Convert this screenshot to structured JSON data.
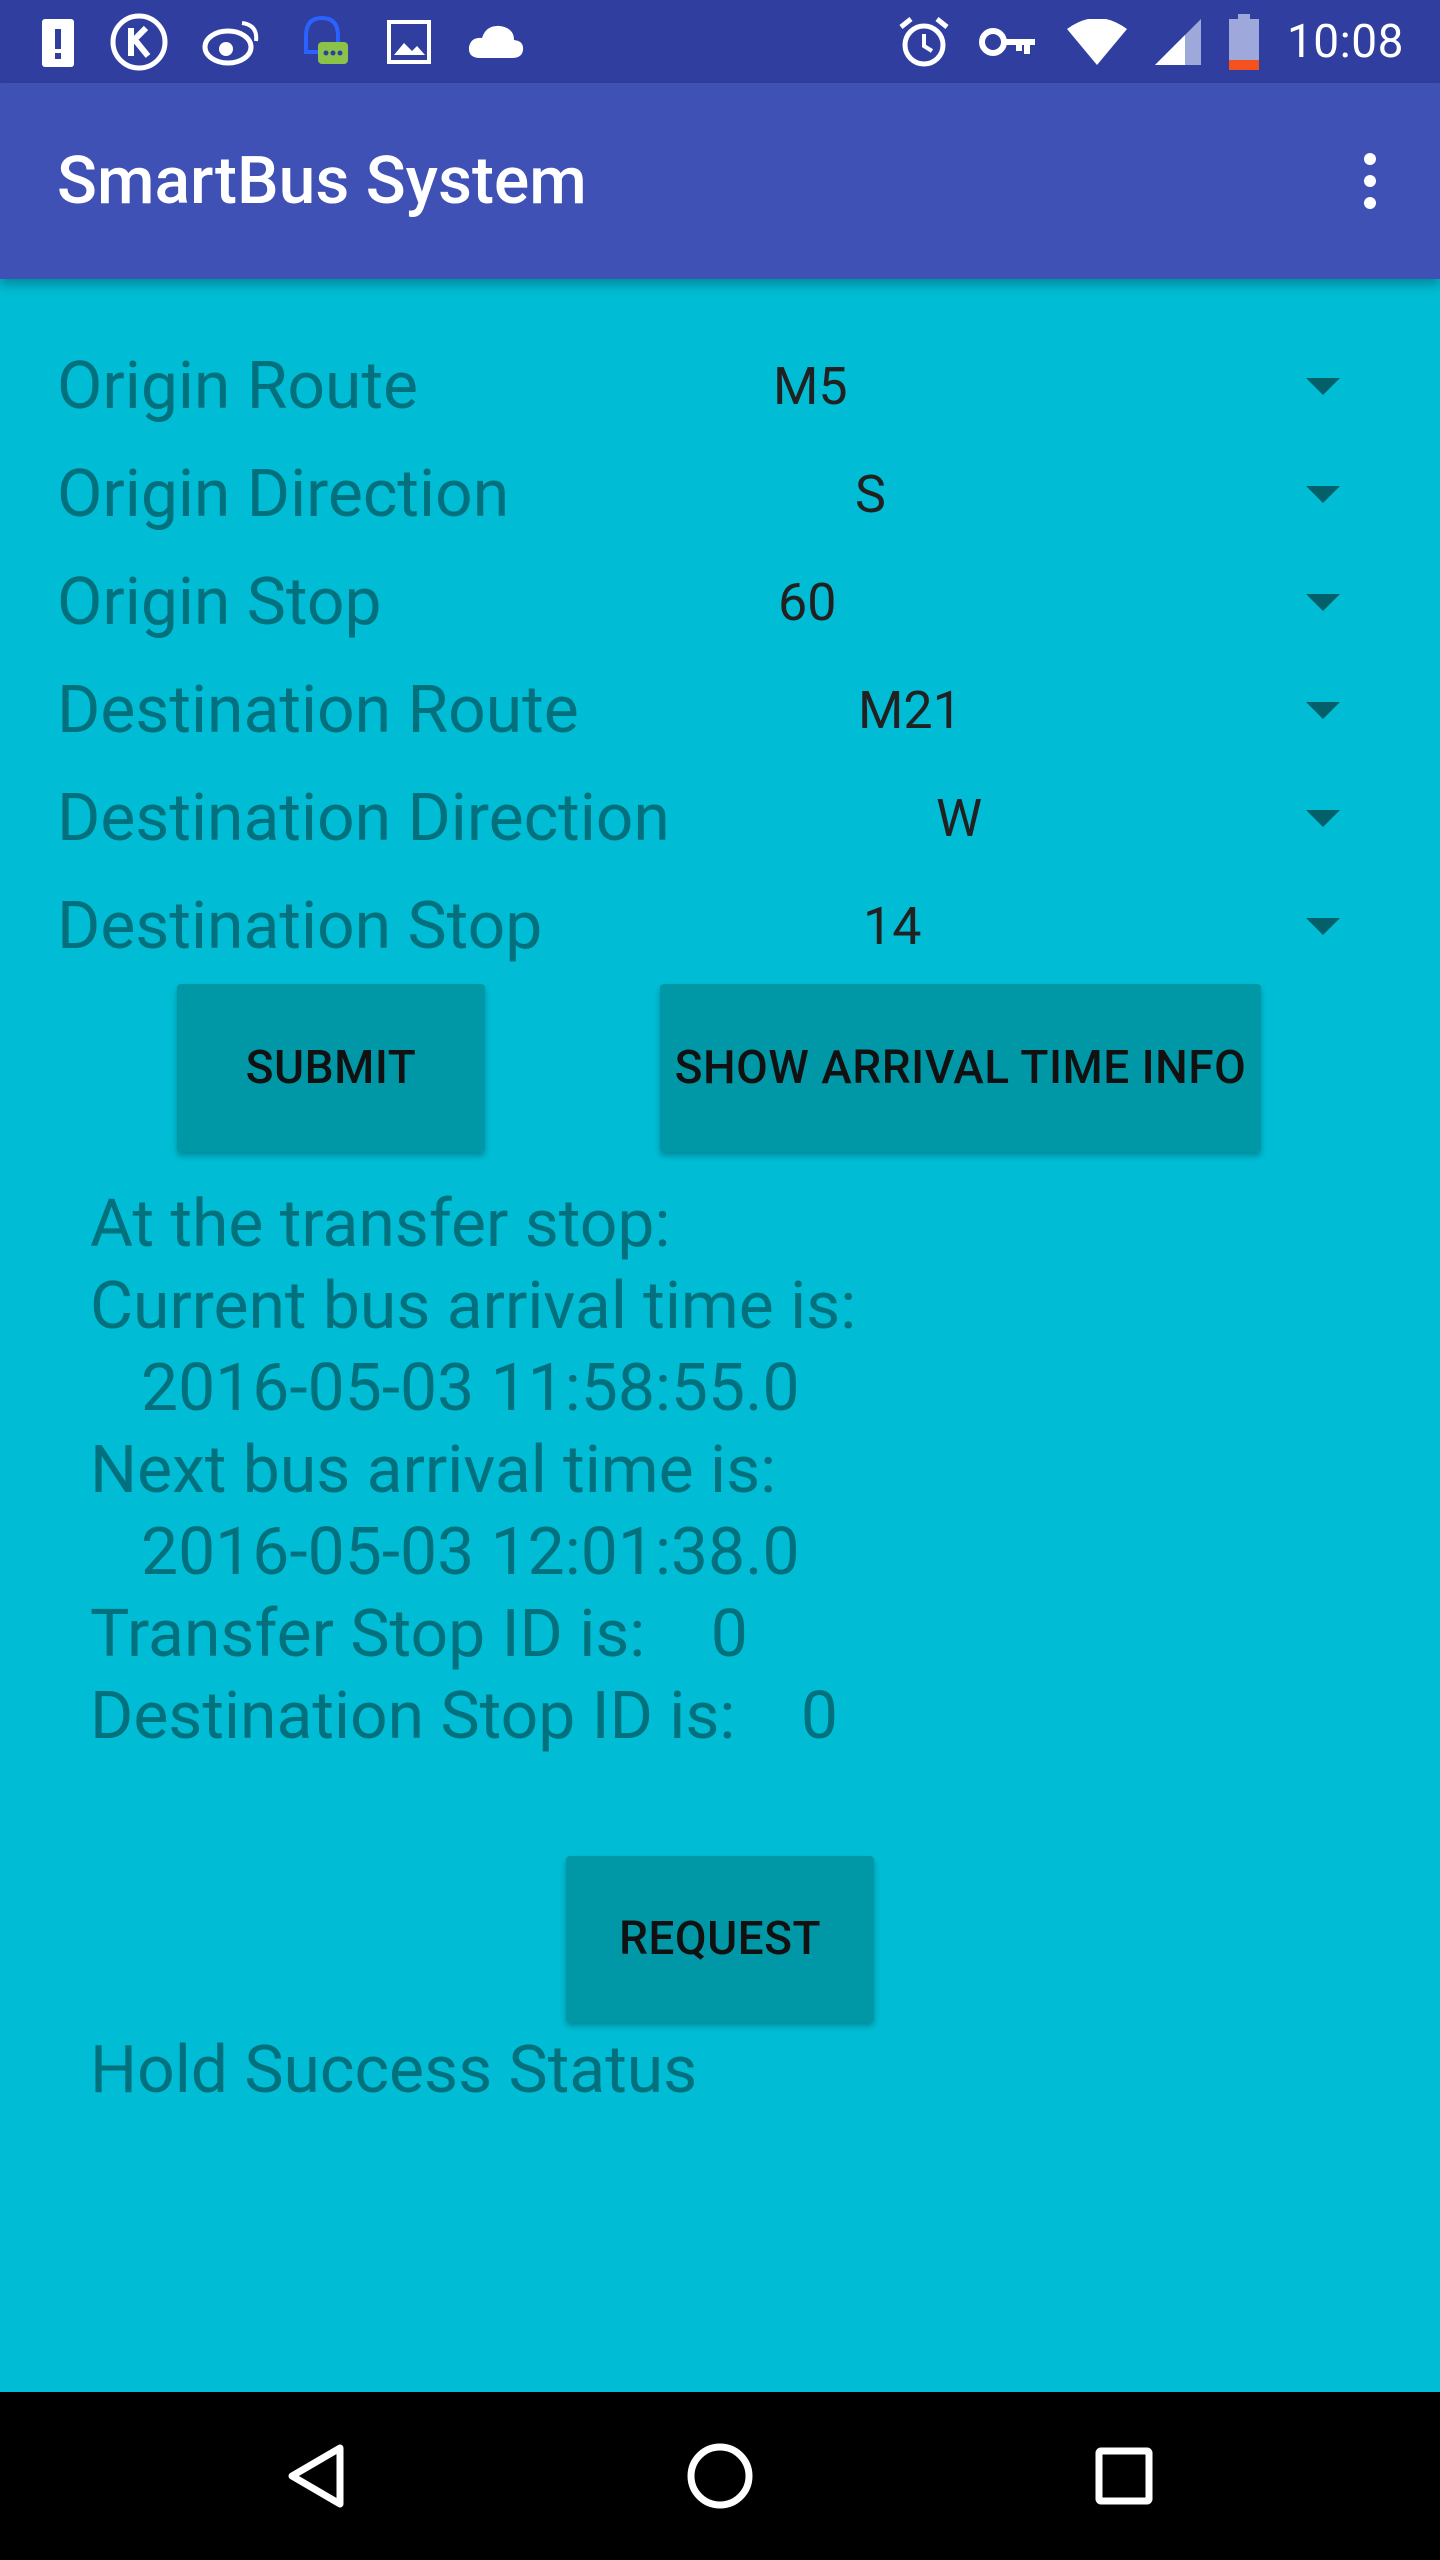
{
  "status_bar": {
    "time": "10:08",
    "left_icons": [
      "alert-icon",
      "k-app-icon",
      "weibo-icon",
      "chat-bell-icon",
      "image-icon",
      "cloud-icon"
    ],
    "right_icons": [
      "alarm-icon",
      "vpn-key-icon",
      "wifi-icon",
      "signal-icon",
      "battery-icon"
    ]
  },
  "app_bar": {
    "title": "SmartBus System",
    "menu_icon": "more-vert-icon"
  },
  "form": {
    "origin_route": {
      "label": "Origin Route",
      "value": "M5"
    },
    "origin_direction": {
      "label": "Origin Direction",
      "value": "S"
    },
    "origin_stop": {
      "label": "Origin Stop",
      "value": "60"
    },
    "destination_route": {
      "label": "Destination Route",
      "value": "M21"
    },
    "destination_direction": {
      "label": "Destination Direction",
      "value": "W"
    },
    "destination_stop": {
      "label": "Destination Stop",
      "value": "14"
    }
  },
  "buttons": {
    "submit": "SUBMIT",
    "show_arrival": "SHOW ARRIVAL TIME INFO",
    "request": "REQUEST"
  },
  "info": {
    "transfer_heading": "At the transfer stop:",
    "current_label": "Current bus arrival time is:",
    "current_time": "2016-05-03 11:58:55.0",
    "next_label": "Next bus arrival time is:",
    "next_time": "2016-05-03 12:01:38.0",
    "transfer_stop_id": "Transfer Stop ID is:    0",
    "destination_stop_id": "Destination Stop ID is:    0",
    "hold_status": "Hold Success Status"
  },
  "colors": {
    "background": "#00BCD4",
    "app_bar": "#3F51B5",
    "status_bar": "#303F9F",
    "button": "#0097A7",
    "label_text": "#03707E"
  },
  "nav_bar": {
    "back_icon": "back-triangle-icon",
    "home_icon": "home-circle-icon",
    "recents_icon": "recents-square-icon"
  }
}
